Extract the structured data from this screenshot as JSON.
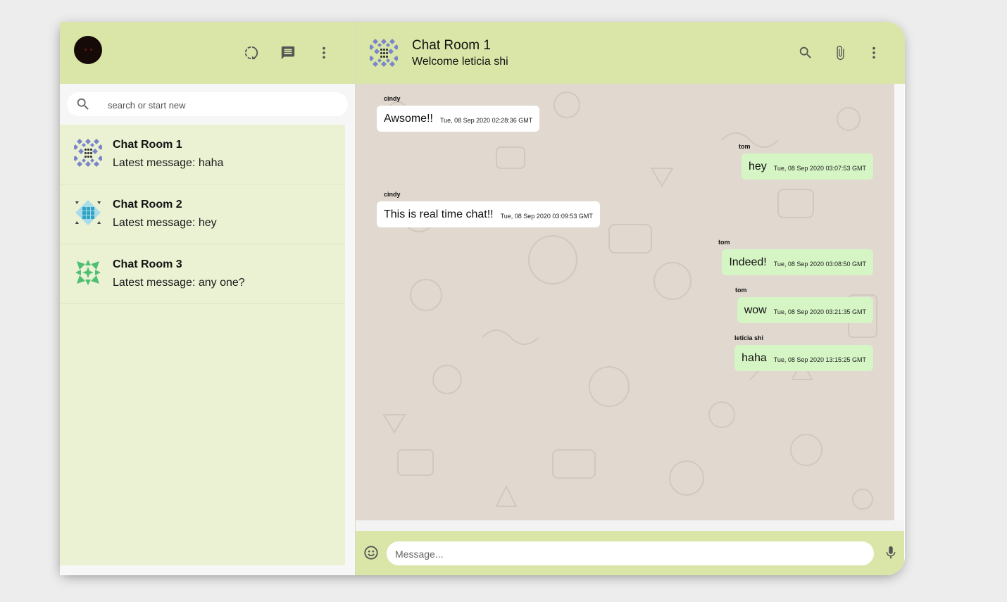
{
  "sidebar": {
    "header_icons": [
      "status-icon",
      "new-chat-icon",
      "more-vert-icon"
    ],
    "search": {
      "placeholder": "search or start new",
      "value": ""
    },
    "chats": [
      {
        "name": "Chat Room 1",
        "last_message": "Latest message: haha",
        "avatar_color": "#7b86c9"
      },
      {
        "name": "Chat Room 2",
        "last_message": "Latest message: hey",
        "avatar_color": "#5bb8d1"
      },
      {
        "name": "Chat Room 3",
        "last_message": "Latest message: any one?",
        "avatar_color": "#4fbf72"
      }
    ]
  },
  "room": {
    "title": "Chat Room 1",
    "subtitle": "Welcome leticia shi",
    "header_icons": [
      "search-icon",
      "attach-icon",
      "more-vert-icon"
    ]
  },
  "messages": [
    {
      "sender": "cindy",
      "text": "Awsome!!",
      "time": "Tue, 08 Sep 2020 02:28:36 GMT",
      "side": "received"
    },
    {
      "sender": "tom",
      "text": "hey",
      "time": "Tue, 08 Sep 2020 03:07:53 GMT",
      "side": "sent"
    },
    {
      "sender": "cindy",
      "text": "This is real time chat!!",
      "time": "Tue, 08 Sep 2020 03:09:53 GMT",
      "side": "received"
    },
    {
      "sender": "tom",
      "text": "Indeed!",
      "time": "Tue, 08 Sep 2020 03:08:50 GMT",
      "side": "sent"
    },
    {
      "sender": "tom",
      "text": "wow",
      "time": "Tue, 08 Sep 2020 03:21:35 GMT",
      "side": "sent"
    },
    {
      "sender": "leticia shi",
      "text": "haha",
      "time": "Tue, 08 Sep 2020 13:15:25 GMT",
      "side": "sent"
    }
  ],
  "composer": {
    "placeholder": "Message...",
    "value": "",
    "icons": [
      "emoji-icon",
      "mic-icon"
    ]
  },
  "colors": {
    "header_bg": "#d9e6a8",
    "sidebar_bg": "#ebf2d4",
    "chat_bg": "#e1d8cf",
    "sent_bubble": "#d6f5c4",
    "received_bubble": "#ffffff"
  }
}
